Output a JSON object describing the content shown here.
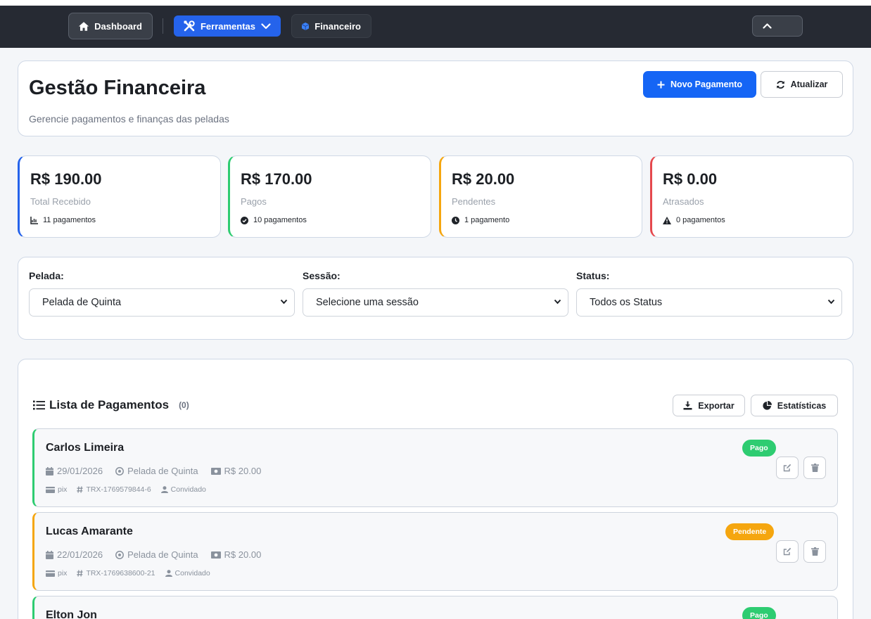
{
  "colors": {
    "primary": "#1565f5",
    "navbar": "#262a33",
    "blue_border": "#2563eb",
    "green": "#2ecc71",
    "orange": "#f5a60f",
    "red": "#e5484d"
  },
  "nav": {
    "dashboard": "Dashboard",
    "ferramentas": "Ferramentas",
    "financeiro": "Financeiro"
  },
  "header": {
    "title": "Gestão Financeira",
    "subtitle": "Gerencie pagamentos e finanças das peladas",
    "new_payment": "Novo Pagamento",
    "refresh": "Atualizar"
  },
  "stats": [
    {
      "amount": "R$ 190.00",
      "label": "Total Recebido",
      "sub": "11 pagamentos",
      "icon": "chart-icon"
    },
    {
      "amount": "R$ 170.00",
      "label": "Pagos",
      "sub": "10 pagamentos",
      "icon": "check-circle-icon"
    },
    {
      "amount": "R$ 20.00",
      "label": "Pendentes",
      "sub": "1 pagamento",
      "icon": "clock-icon"
    },
    {
      "amount": "R$ 0.00",
      "label": "Atrasados",
      "sub": "0 pagamentos",
      "icon": "warning-icon"
    }
  ],
  "filters": {
    "pelada_label": "Pelada:",
    "pelada_value": "Pelada de Quinta",
    "sessao_label": "Sessão:",
    "sessao_value": "Selecione uma sessão",
    "status_label": "Status:",
    "status_value": "Todos os Status"
  },
  "list": {
    "title": "Lista de Pagamentos",
    "count": "(0)",
    "export": "Exportar",
    "stats": "Estatísticas",
    "payments": [
      {
        "name": "Carlos Limeira",
        "date": "29/01/2026",
        "pelada": "Pelada de Quinta",
        "amount": "R$ 20.00",
        "method": "pix",
        "trx": "TRX-1769579844-6",
        "type": "Convidado",
        "status": "Pago"
      },
      {
        "name": "Lucas Amarante",
        "date": "22/01/2026",
        "pelada": "Pelada de Quinta",
        "amount": "R$ 20.00",
        "method": "pix",
        "trx": "TRX-1769638600-21",
        "type": "Convidado",
        "status": "Pendente"
      },
      {
        "name": "Elton Jon",
        "status": "Pago"
      }
    ]
  }
}
